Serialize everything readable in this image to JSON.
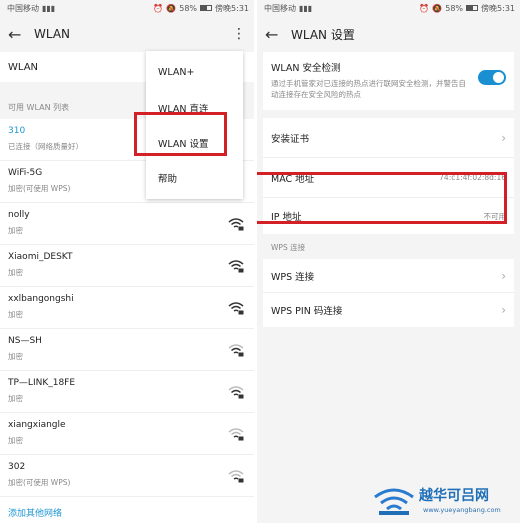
{
  "left": {
    "status": {
      "carrier": "中国移动",
      "battery": "58%",
      "time": "傍晚5:31"
    },
    "title": "WLAN",
    "wlan_label": "WLAN",
    "list_header": "可用 WLAN 列表",
    "networks": [
      {
        "name": "310",
        "status": "已连接（网络质量好）",
        "connected": true
      },
      {
        "name": "WiFi-5G",
        "status": "加密(可使用 WPS)"
      },
      {
        "name": "nolly",
        "status": "加密"
      },
      {
        "name": "Xiaomi_DESKT",
        "status": "加密"
      },
      {
        "name": "xxlbangongshi",
        "status": "加密"
      },
      {
        "name": "NS—SH",
        "status": "加密"
      },
      {
        "name": "TP—LINK_18FE",
        "status": "加密"
      },
      {
        "name": "xiangxiangle",
        "status": "加密"
      },
      {
        "name": "302",
        "status": "加密(可使用 WPS)"
      }
    ],
    "add_network": "添加其他网络",
    "menu": [
      "WLAN+",
      "WLAN 直连",
      "WLAN 设置",
      "帮助"
    ]
  },
  "right": {
    "status": {
      "carrier": "中国移动",
      "battery": "58%",
      "time": "傍晚5:31"
    },
    "title": "WLAN 设置",
    "security": {
      "title": "WLAN 安全检测",
      "desc": "通过手机管家对已连接的热点进行联网安全检测，并警告自动连接存在安全风险的热点",
      "enabled": true
    },
    "rows": [
      {
        "label": "安装证书",
        "value": ""
      },
      {
        "label": "MAC 地址",
        "value": "74:c1:4f:02:8d:16"
      }
    ],
    "ip": {
      "label": "IP 地址",
      "value": "不可用"
    },
    "wps_header": "WPS 连接",
    "wps_rows": [
      {
        "label": "WPS 连接"
      },
      {
        "label": "WPS PIN 码连接"
      }
    ]
  },
  "watermark": {
    "text": "越华可吕网",
    "url": "www.yueyangbang.com"
  },
  "colors": {
    "accent": "#1a8fd1",
    "highlight": "#d32027",
    "link": "#2196d3"
  }
}
